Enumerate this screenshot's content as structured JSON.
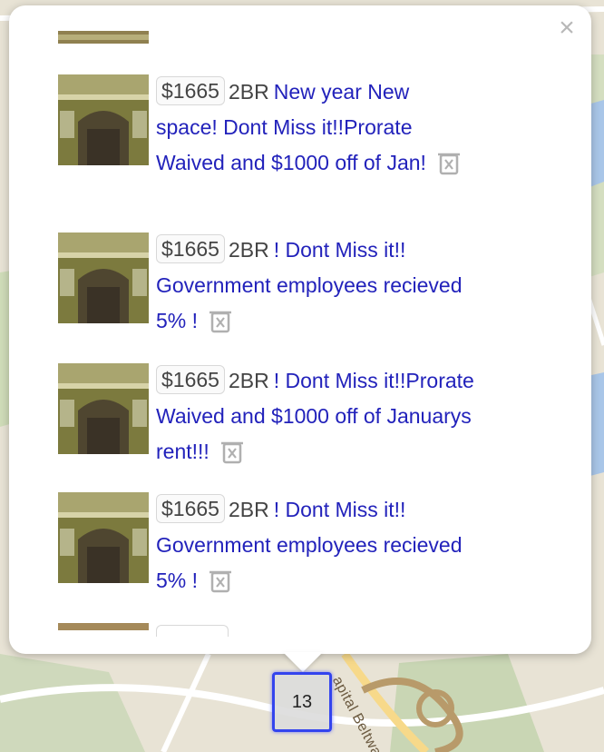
{
  "map": {
    "road_label": "apital Beltway"
  },
  "popup": {
    "close_label": "×",
    "listings": [
      {
        "price": "$1665",
        "beds": "2BR",
        "title": "New year New space! Dont Miss it!!Prorate Waived and $1000 off of Jan!"
      },
      {
        "price": "$1665",
        "beds": "2BR",
        "title": "! Dont Miss it!! Government employees recieved 5% !"
      },
      {
        "price": "$1665",
        "beds": "2BR",
        "title": "! Dont Miss it!!Prorate Waived and $1000 off of Januarys rent!!!"
      },
      {
        "price": "$1665",
        "beds": "2BR",
        "title": "! Dont Miss it!! Government employees recieved 5% !"
      }
    ]
  },
  "cluster": {
    "count": "13"
  },
  "colors": {
    "link": "#2222bb",
    "cluster_border": "#3344ee",
    "popup_bg": "#ffffff"
  },
  "icons": {
    "close": "close-icon",
    "trash": "trash-icon"
  }
}
